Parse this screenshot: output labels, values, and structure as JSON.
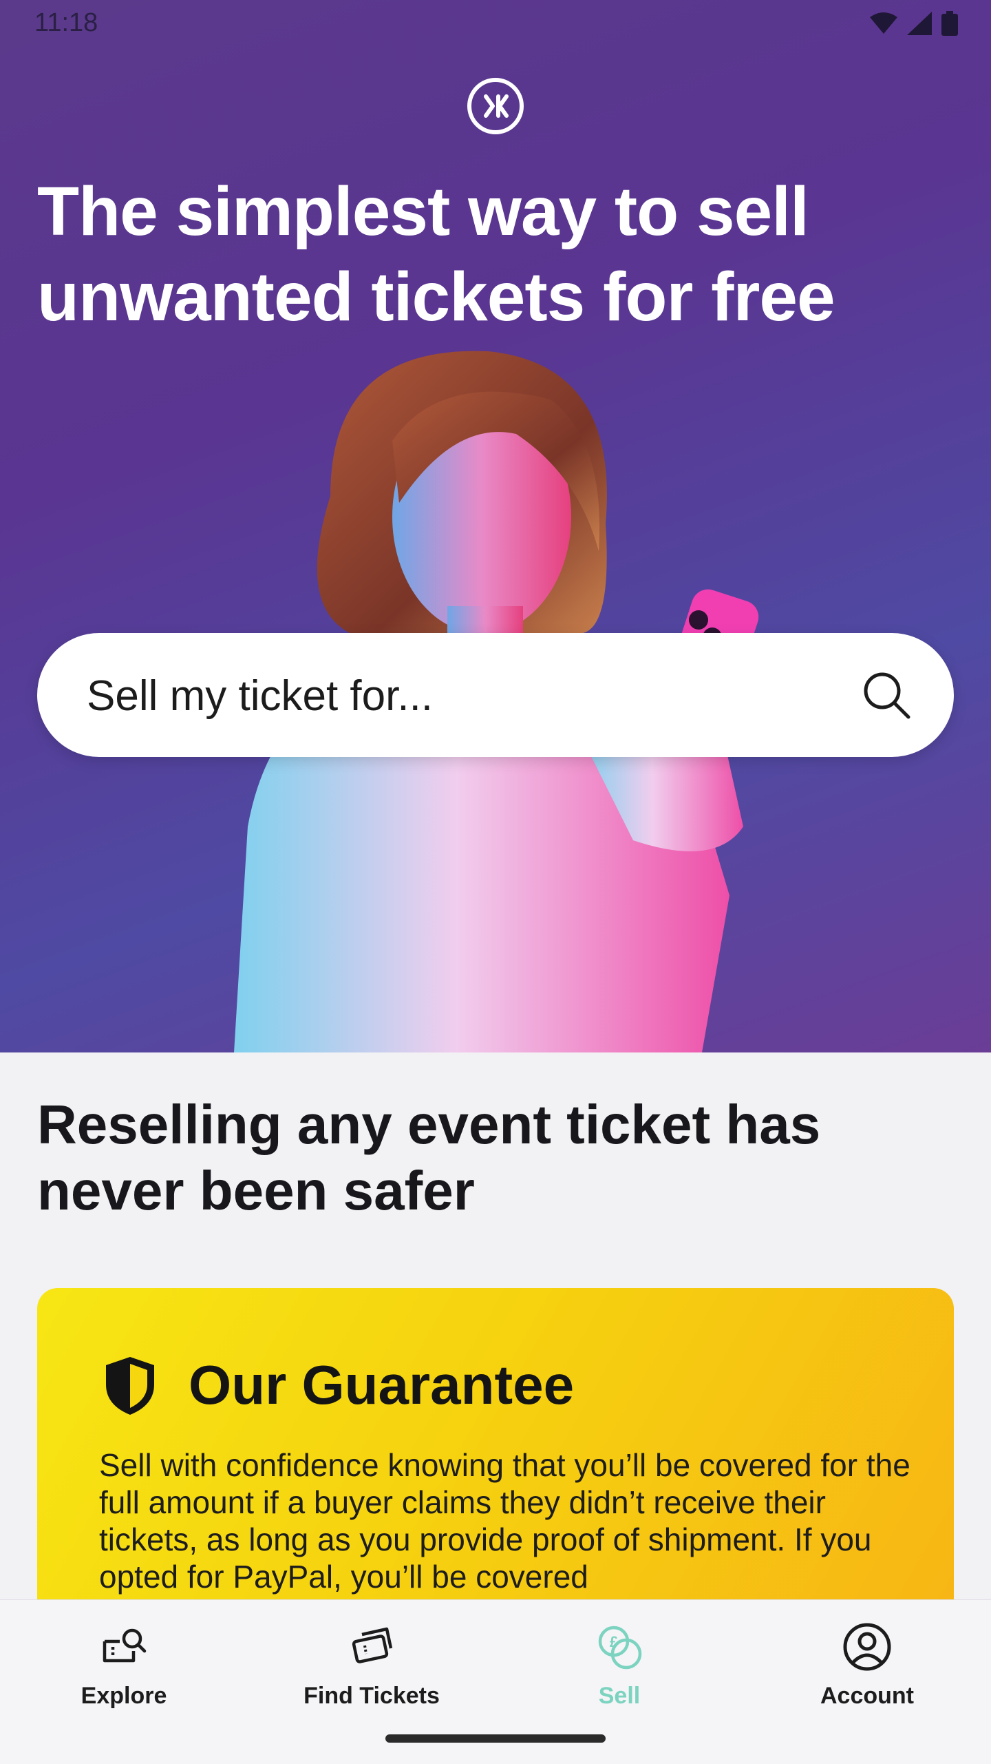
{
  "status_bar": {
    "time": "11:18"
  },
  "hero": {
    "title": "The simplest way to sell unwanted tickets for free",
    "search_placeholder": "Sell my ticket for..."
  },
  "section": {
    "title": "Reselling any event ticket has never been safer"
  },
  "guarantee": {
    "title": "Our Guarantee",
    "body": "Sell with confidence knowing that you’ll be covered for the full amount if a buyer claims they didn’t receive their tickets, as long as you provide proof of shipment. If you opted for PayPal, you’ll be covered"
  },
  "nav": {
    "items": [
      {
        "label": "Explore",
        "icon": "explore-icon",
        "active": false
      },
      {
        "label": "Find Tickets",
        "icon": "tickets-icon",
        "active": false
      },
      {
        "label": "Sell",
        "icon": "sell-icon",
        "active": true
      },
      {
        "label": "Account",
        "icon": "account-icon",
        "active": false
      }
    ]
  },
  "colors": {
    "hero_bg": "#5a3591",
    "guarantee_bg": "#f7d514",
    "active_nav": "#7bd3c0"
  }
}
